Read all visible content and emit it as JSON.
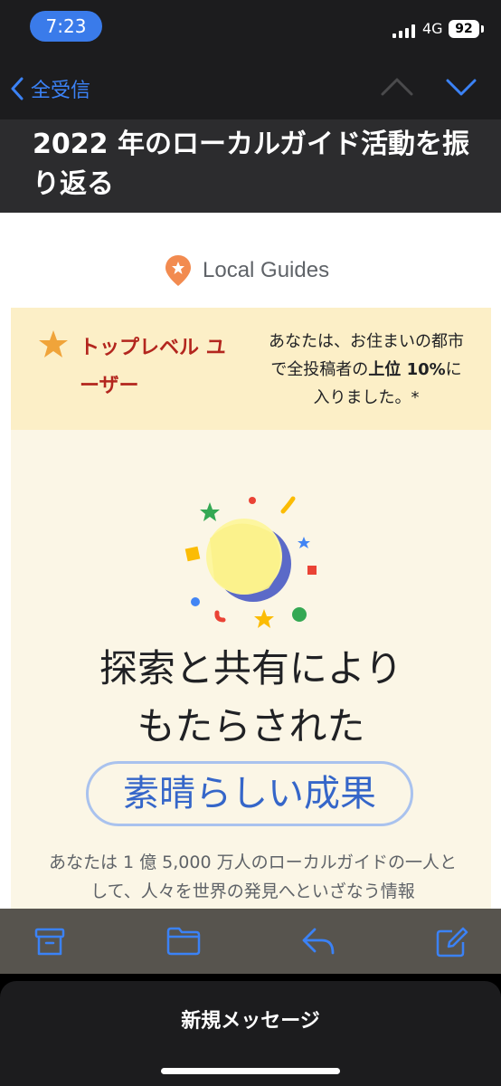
{
  "status_bar": {
    "time": "7:23",
    "network": "4G",
    "battery": "92"
  },
  "nav": {
    "back_label": "全受信"
  },
  "email": {
    "subject": "2022 年のローカルガイド活動を振り返る",
    "logo_text": "Local Guides",
    "banner": {
      "title": "トップレベル ユーザー",
      "desc_part1": "あなたは、お住まいの都市で全投稿者の",
      "desc_bold1": "上位 10%",
      "desc_part2": "に入りました。*"
    },
    "headline_line1": "探索と共有により",
    "headline_line2": "もたらされた",
    "highlight": "素晴らしい成果",
    "body": "あなたは 1 億 5,000 万人のローカルガイドの一人として、人々を世界の発見へといざなう情報"
  },
  "toolbar": {
    "icons": [
      "archive-icon",
      "folder-icon",
      "reply-icon",
      "compose-icon"
    ]
  },
  "compose_sheet": {
    "title": "新規メッセージ"
  },
  "colors": {
    "accent": "#3b82f6",
    "banner_bg": "#fcefc7",
    "banner_title": "#b3261e",
    "cream_bg": "#fbf6e6",
    "highlight_text": "#3566c9"
  }
}
